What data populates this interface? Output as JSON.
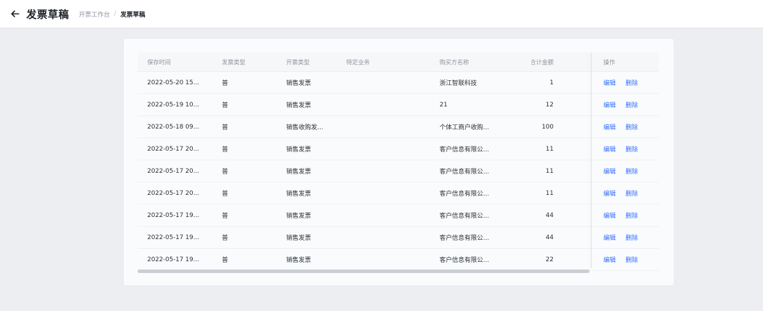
{
  "header": {
    "title": "发票草稿",
    "breadcrumb": [
      "开票工作台",
      "发票草稿"
    ]
  },
  "table": {
    "columns": [
      "保存时间",
      "发票类型",
      "开票类型",
      "特定业务",
      "购买方名称",
      "合计金额",
      "",
      "操作"
    ],
    "rows": [
      {
        "time": "2022-05-20 15...",
        "type": "普",
        "kind": "销售发票",
        "plat": "",
        "buyer": "浙江智联科技",
        "amount": "1",
        "ops": [
          "编辑",
          "删除"
        ]
      },
      {
        "time": "2022-05-19 10...",
        "type": "普",
        "kind": "销售发票",
        "plat": "",
        "buyer": "21",
        "amount": "12",
        "ops": [
          "编辑",
          "删除"
        ]
      },
      {
        "time": "2022-05-18 09...",
        "type": "普",
        "kind": "销售收购发...",
        "plat": "",
        "buyer": "个体工商户收购...",
        "amount": "100",
        "ops": [
          "编辑",
          "删除"
        ]
      },
      {
        "time": "2022-05-17 20...",
        "type": "普",
        "kind": "销售发票",
        "plat": "",
        "buyer": "客户信息有限公...",
        "amount": "11",
        "ops": [
          "编辑",
          "删除"
        ]
      },
      {
        "time": "2022-05-17 20...",
        "type": "普",
        "kind": "销售发票",
        "plat": "",
        "buyer": "客户信息有限公...",
        "amount": "11",
        "ops": [
          "编辑",
          "删除"
        ]
      },
      {
        "time": "2022-05-17 20...",
        "type": "普",
        "kind": "销售发票",
        "plat": "",
        "buyer": "客户信息有限公...",
        "amount": "11",
        "ops": [
          "编辑",
          "删除"
        ]
      },
      {
        "time": "2022-05-17 19...",
        "type": "普",
        "kind": "销售发票",
        "plat": "",
        "buyer": "客户信息有限公...",
        "amount": "44",
        "ops": [
          "编辑",
          "删除"
        ]
      },
      {
        "time": "2022-05-17 19...",
        "type": "普",
        "kind": "销售发票",
        "plat": "",
        "buyer": "客户信息有限公...",
        "amount": "44",
        "ops": [
          "编辑",
          "删除"
        ]
      },
      {
        "time": "2022-05-17 19...",
        "type": "普",
        "kind": "销售发票",
        "plat": "",
        "buyer": "客户信息有限公...",
        "amount": "22",
        "ops": [
          "编辑",
          "删除"
        ]
      }
    ]
  },
  "colors": {
    "link": "#3370ff",
    "background": "#eceef1",
    "title": "#1f2329"
  },
  "icons": {
    "back": "arrow-left-icon"
  }
}
